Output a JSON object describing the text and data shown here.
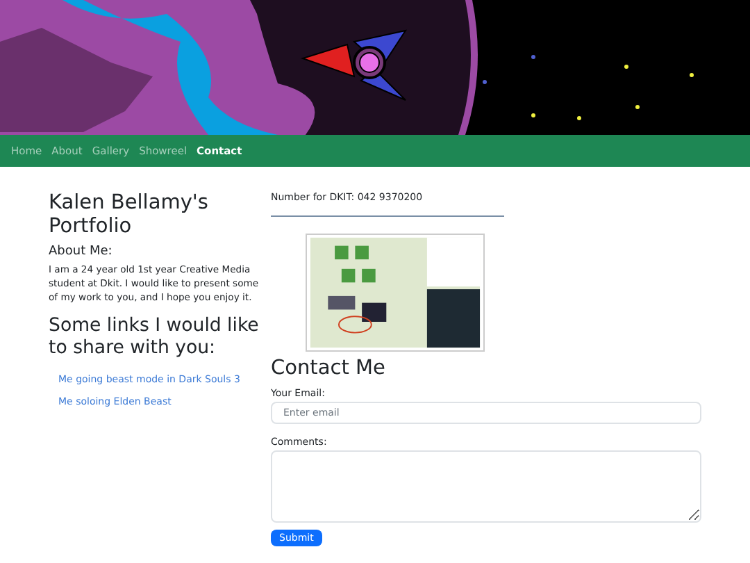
{
  "nav": {
    "items": [
      {
        "label": "Home",
        "selected": false
      },
      {
        "label": "About",
        "selected": false
      },
      {
        "label": "Gallery",
        "selected": false
      },
      {
        "label": "Showreel",
        "selected": false
      },
      {
        "label": "Contact",
        "selected": true
      }
    ]
  },
  "about": {
    "title": "Kalen Bellamy's Portfolio",
    "subtitle": "About Me:",
    "text": "I am a 24 year old 1st year Creative Media student at Dkit. I would like to present some of my work to you, and I hope you enjoy it.",
    "links_title": "Some links I would like to share with you:",
    "links": [
      "Me going beast mode in Dark Souls 3",
      "Me soloing Elden Beast"
    ]
  },
  "phone": "Number for DKIT: 042 9370200",
  "contact": {
    "title": "Contact Me",
    "email_label": "Your Email:",
    "email_placeholder": "Enter email",
    "comments_label": "Comments:",
    "submit": "Submit"
  }
}
